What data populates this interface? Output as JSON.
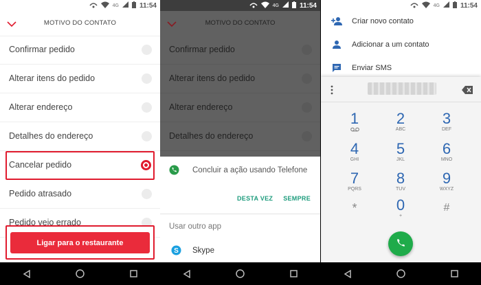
{
  "status": {
    "time": "11:54",
    "network": "4G"
  },
  "screen1": {
    "title": "MOTIVO DO CONTATO",
    "options": [
      {
        "label": "Confirmar pedido",
        "selected": false
      },
      {
        "label": "Alterar itens do pedido",
        "selected": false
      },
      {
        "label": "Alterar endereço",
        "selected": false
      },
      {
        "label": "Detalhes do endereço",
        "selected": false
      },
      {
        "label": "Cancelar pedido",
        "selected": true
      },
      {
        "label": "Pedido atrasado",
        "selected": false
      },
      {
        "label": "Pedido veio errado",
        "selected": false
      }
    ],
    "call_button": "Ligar para o restaurante",
    "accent": "#e01a2d"
  },
  "screen2": {
    "title": "MOTIVO DO CONTATO",
    "options": [
      "Confirmar pedido",
      "Alterar itens do pedido",
      "Alterar endereço",
      "Detalhes do endereço"
    ],
    "sheet": {
      "prompt": "Concluir a ação usando Telefone",
      "once": "DESTA VEZ",
      "always": "SEMPRE",
      "other_app": "Usar outro app",
      "app_name": "Skype"
    }
  },
  "screen3": {
    "menu": [
      {
        "label": "Criar novo contato",
        "icon": "add-person-icon"
      },
      {
        "label": "Adicionar a um contato",
        "icon": "person-icon"
      },
      {
        "label": "Enviar SMS",
        "icon": "message-icon"
      }
    ],
    "keys": [
      {
        "digit": "1",
        "letters": "voicemail"
      },
      {
        "digit": "2",
        "letters": "ABC"
      },
      {
        "digit": "3",
        "letters": "DEF"
      },
      {
        "digit": "4",
        "letters": "GHI"
      },
      {
        "digit": "5",
        "letters": "JKL"
      },
      {
        "digit": "6",
        "letters": "MNO"
      },
      {
        "digit": "7",
        "letters": "PQRS"
      },
      {
        "digit": "8",
        "letters": "TUV"
      },
      {
        "digit": "9",
        "letters": "WXYZ"
      },
      {
        "digit": "*",
        "letters": ""
      },
      {
        "digit": "0",
        "letters": "+"
      },
      {
        "digit": "#",
        "letters": ""
      }
    ],
    "dial_color": "#2e67b2",
    "call_color": "#1fab4a"
  }
}
